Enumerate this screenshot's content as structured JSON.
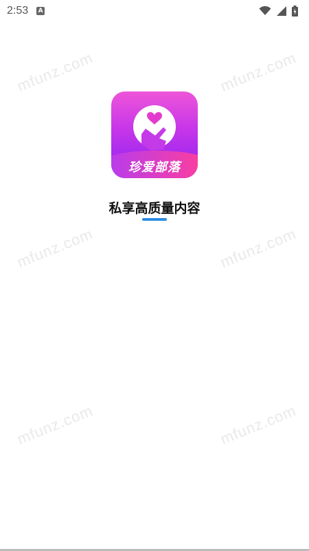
{
  "status_bar": {
    "time": "2:53",
    "indicator": "A",
    "icons": [
      "wifi-icon",
      "cell-signal-icon",
      "battery-icon"
    ]
  },
  "watermarks": [
    "mfunz.com",
    "mfunz.com",
    "mfunz.com",
    "mfunz.com",
    "mfunz.com",
    "mfunz.com"
  ],
  "app": {
    "icon_label": "珍爱部落",
    "tagline": "私享高质量内容"
  },
  "colors": {
    "icon_gradient_top": "#ee55d8",
    "icon_gradient_bottom": "#8a22f0",
    "ribbon_left": "#b43cf0",
    "ribbon_right": "#ff3f9a",
    "heart": "#e23ccf",
    "accent_bar": "#2f8de4"
  }
}
